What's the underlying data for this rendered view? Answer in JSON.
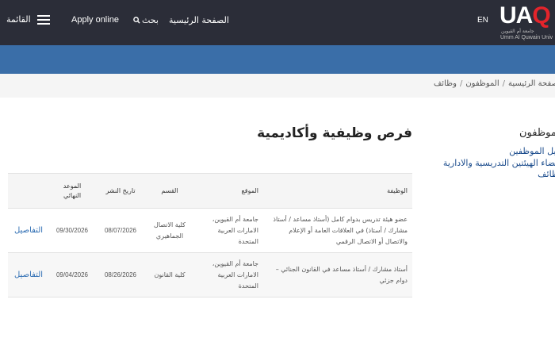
{
  "header": {
    "logo": {
      "mark_main": "UA",
      "mark_q": "Q",
      "arabic_name": "جامعة أم القيوين",
      "english_name": "Umm Al Quwain Univ"
    },
    "lang_label": "EN",
    "home_label": "الصفحة الرئيسية",
    "search_label": "بحث",
    "apply_label": "Apply online",
    "menu_label": "القائمة"
  },
  "colors": {
    "header_bg": "#2b2d38",
    "band_bg": "#3a6ea8",
    "link": "#2d6db3",
    "logo_accent": "#e3242b"
  },
  "breadcrumb": [
    "الصفحة الرئيسية",
    "الموظفون",
    "وظائف"
  ],
  "sidebar": {
    "title": "الموظفون",
    "items": [
      "دليل الموظفين",
      "أعضاء الهيئتين التدريسية والادارية",
      "وظائف"
    ]
  },
  "main": {
    "title": "فرص وظيفية وأكاديمية",
    "table": {
      "headers": {
        "job": "الوظيفة",
        "location": "الموقع",
        "department": "القسم",
        "published": "تاريخ النشر",
        "deadline": "الموعد النهائي"
      },
      "rows": [
        {
          "job": "عضو هيئة تدريس بدوام كامل (أستاذ مساعد / أستاذ مشارك / أستاذ) في العلاقات العامة أو الإعلام والاتصال أو الاتصال الرقمي",
          "location": "جامعة أم القيوين، الامارات العربية المتحدة",
          "department": "كلية الاتصال الجماهيري",
          "published": "08/07/2026",
          "deadline": "09/30/2026",
          "action": "التفاصيل"
        },
        {
          "job": "أستاذ مشارك / أستاذ مساعد في القانون الجنائي – دوام جزئي",
          "location": "جامعة أم القيوين، الامارات العربية المتحدة",
          "department": "كلية القانون",
          "published": "08/26/2026",
          "deadline": "09/04/2026",
          "action": "التفاصيل"
        }
      ]
    }
  }
}
